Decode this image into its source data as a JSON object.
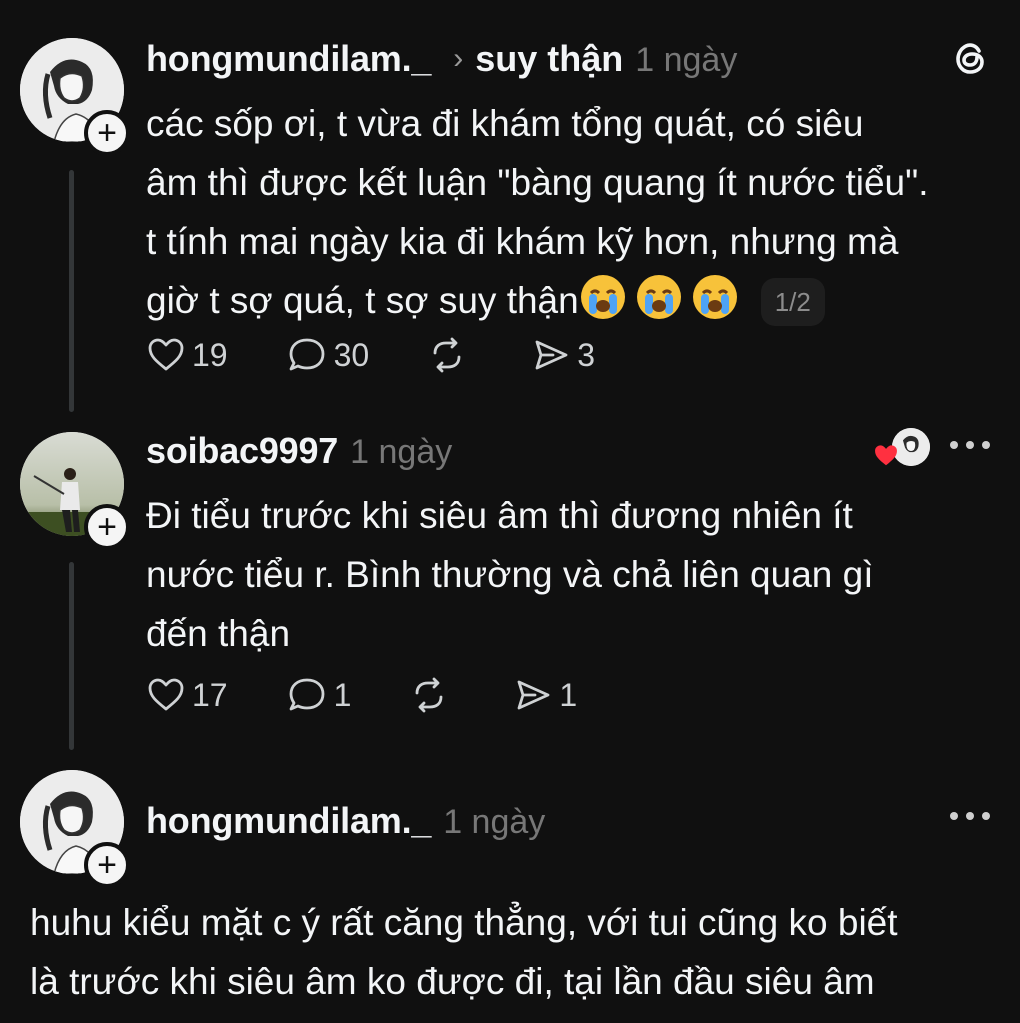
{
  "posts": [
    {
      "username": "hongmundilam._",
      "topic": "suy thận",
      "time": "1 ngày",
      "lines": [
        "các sốp ơi, t vừa đi khám tổng quát, có siêu",
        "âm thì được kết luận \"bàng quang ít nước tiểu\".",
        "t tính mai ngày kia đi khám kỹ hơn, nhưng mà",
        "giờ t sợ quá, t sợ suy thận"
      ],
      "page_indicator": "1/2",
      "likes": "19",
      "replies": "30",
      "shares": "3"
    },
    {
      "username": "soibac9997",
      "time": "1 ngày",
      "lines": [
        "Đi tiểu trước khi siêu âm thì đương nhiên ít",
        "nước tiểu r. Bình thường và chả liên quan gì",
        "đến thận"
      ],
      "likes": "17",
      "replies": "1",
      "shares": "1"
    },
    {
      "username": "hongmundilam._",
      "time": "1 ngày",
      "lines": [
        "huhu kiểu mặt c ý rất căng thẳng, với tui cũng ko biết",
        "là trước khi siêu âm ko được đi, tại lần đầu siêu âm"
      ]
    }
  ],
  "icons": {
    "app_logo": "threads-logo-icon",
    "like": "heart-icon",
    "reply": "comment-icon",
    "repost": "repost-icon",
    "share": "send-icon",
    "more": "more-dots-icon",
    "crying_emoji": "loudly-crying-face-emoji"
  },
  "colors": {
    "background": "#101010",
    "text": "#f3f5f7",
    "muted": "#777777",
    "liked_heart": "#ff3040"
  }
}
